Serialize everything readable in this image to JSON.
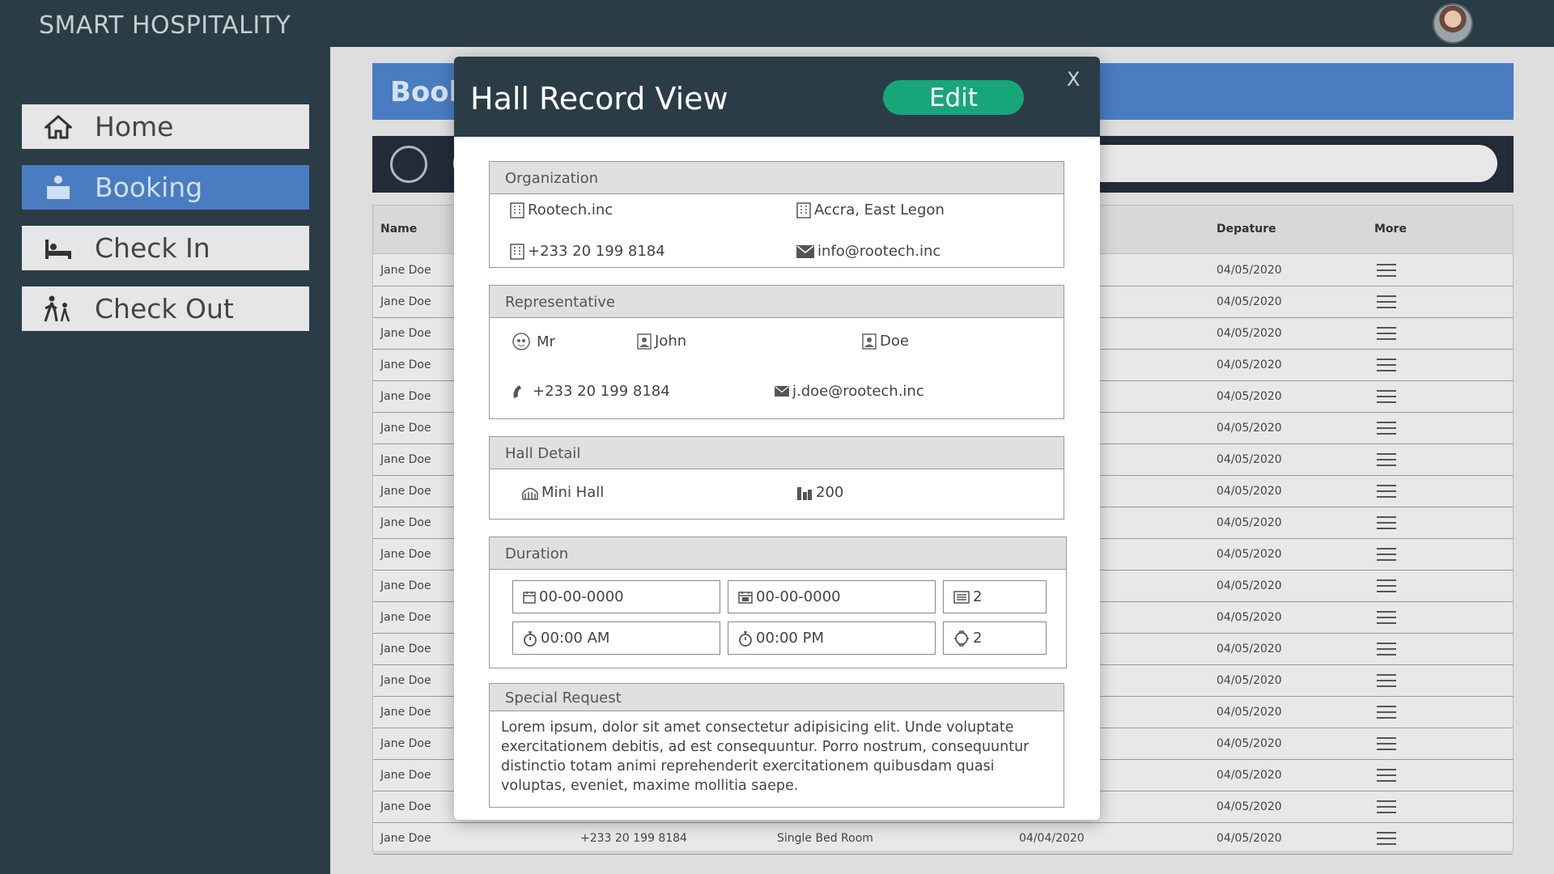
{
  "app": {
    "brand": "SMART HOSPITALITY"
  },
  "sidebar": {
    "items": [
      {
        "label": "Home",
        "icon": "home-icon",
        "active": false
      },
      {
        "label": "Booking",
        "icon": "reception-icon",
        "active": true
      },
      {
        "label": "Check In",
        "icon": "bed-icon",
        "active": false
      },
      {
        "label": "Check Out",
        "icon": "walking-icon",
        "active": false
      }
    ]
  },
  "main": {
    "header_title": "Booking",
    "table": {
      "columns": [
        "Name",
        "Depature",
        "More"
      ],
      "rows": [
        {
          "name": "Jane Doe",
          "departure": "04/05/2020"
        },
        {
          "name": "Jane Doe",
          "departure": "04/05/2020"
        },
        {
          "name": "Jane Doe",
          "departure": "04/05/2020"
        },
        {
          "name": "Jane Doe",
          "departure": "04/05/2020"
        },
        {
          "name": "Jane Doe",
          "departure": "04/05/2020"
        },
        {
          "name": "Jane Doe",
          "departure": "04/05/2020"
        },
        {
          "name": "Jane Doe",
          "departure": "04/05/2020"
        },
        {
          "name": "Jane Doe",
          "departure": "04/05/2020"
        },
        {
          "name": "Jane Doe",
          "departure": "04/05/2020"
        },
        {
          "name": "Jane Doe",
          "departure": "04/05/2020"
        },
        {
          "name": "Jane Doe",
          "departure": "04/05/2020"
        },
        {
          "name": "Jane Doe",
          "departure": "04/05/2020"
        },
        {
          "name": "Jane Doe",
          "departure": "04/05/2020"
        },
        {
          "name": "Jane Doe",
          "departure": "04/05/2020"
        },
        {
          "name": "Jane Doe",
          "departure": "04/05/2020"
        },
        {
          "name": "Jane Doe",
          "departure": "04/05/2020"
        },
        {
          "name": "Jane Doe",
          "departure": "04/05/2020"
        },
        {
          "name": "Jane Doe",
          "departure": "04/05/2020"
        },
        {
          "name": "Jane Doe",
          "phone": "+233 20 199 8184",
          "room": "Single Bed Room",
          "arrival": "04/04/2020",
          "departure": "04/05/2020"
        }
      ]
    }
  },
  "modal": {
    "title": "Hall Record View",
    "edit_label": "Edit",
    "close_label": "X",
    "organization": {
      "heading": "Organization",
      "name": "Rootech.inc",
      "location": "Accra, East Legon",
      "phone": "+233 20 199 8184",
      "email": "info@rootech.inc"
    },
    "representative": {
      "heading": "Representative",
      "title": "Mr",
      "first_name": "John",
      "last_name": "Doe",
      "phone": "+233 20 199 8184",
      "email": "j.doe@rootech.inc"
    },
    "hall": {
      "heading": "Hall Detail",
      "name": "Mini Hall",
      "capacity": "200"
    },
    "duration": {
      "heading": "Duration",
      "start_date": "00-00-0000",
      "end_date": "00-00-0000",
      "days": "2",
      "start_time": "00:00 AM",
      "end_time": "00:00 PM",
      "hours": "2"
    },
    "special_request": {
      "heading": "Special Request",
      "text": "Lorem ipsum, dolor sit amet consectetur adipisicing elit. Unde voluptate exercitationem debitis, ad est consequuntur. Porro nostrum, consequuntur distinctio totam animi reprehenderit exercitationem quibusdam quasi voluptas, eveniet, maxime mollitia saepe."
    },
    "colors": {
      "header": "#2a3d46",
      "edit": "#17a67a"
    }
  }
}
